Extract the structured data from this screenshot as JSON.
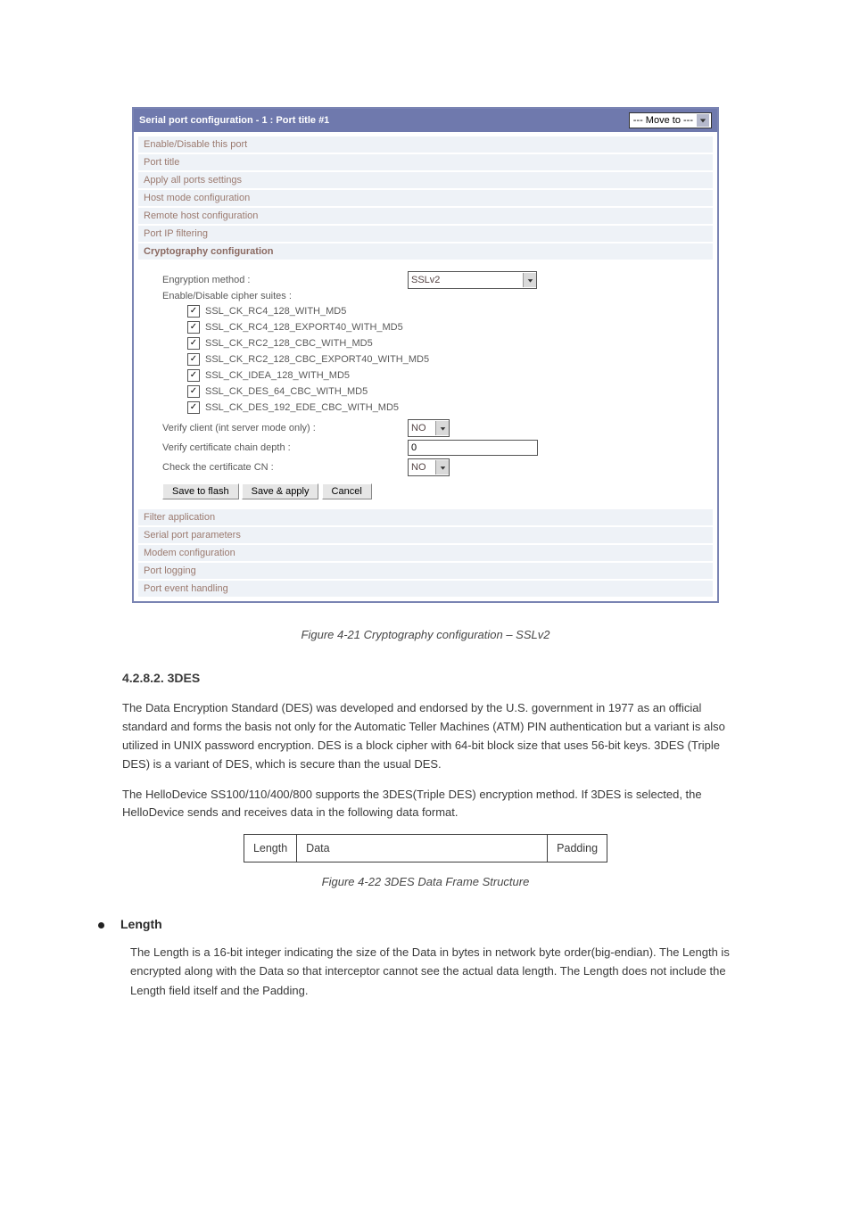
{
  "titlebar": {
    "title": "Serial port configuration - 1 : Port title #1",
    "move_to": "--- Move to ---"
  },
  "nav_top": [
    "Enable/Disable this port",
    "Port title",
    "Apply all ports settings",
    "Host mode configuration",
    "Remote host configuration",
    "Port IP filtering"
  ],
  "active_section": "Cryptography configuration",
  "form": {
    "encryption_label": "Engryption method :",
    "encryption_value": "SSLv2",
    "cipher_head": "Enable/Disable cipher suites :",
    "ciphers": [
      "SSL_CK_RC4_128_WITH_MD5",
      "SSL_CK_RC4_128_EXPORT40_WITH_MD5",
      "SSL_CK_RC2_128_CBC_WITH_MD5",
      "SSL_CK_RC2_128_CBC_EXPORT40_WITH_MD5",
      "SSL_CK_IDEA_128_WITH_MD5",
      "SSL_CK_DES_64_CBC_WITH_MD5",
      "SSL_CK_DES_192_EDE_CBC_WITH_MD5"
    ],
    "verify_client_label": "Verify client (int server mode only) :",
    "verify_client_value": "NO",
    "cert_depth_label": "Verify certificate chain depth :",
    "cert_depth_value": "0",
    "check_cn_label": "Check the certificate CN :",
    "check_cn_value": "NO",
    "btn_save_flash": "Save to flash",
    "btn_save_apply": "Save & apply",
    "btn_cancel": "Cancel"
  },
  "nav_bottom": [
    "Filter application",
    "Serial port parameters",
    "Modem configuration",
    "Port logging",
    "Port event handling"
  ],
  "fig_caption": "Figure 4-21 Cryptography configuration – SSLv2",
  "threedes": {
    "heading": "4.2.8.2.  3DES",
    "para1": "The Data Encryption Standard (DES) was developed and endorsed by the U.S. government in 1977 as an official standard and forms the basis not only for the Automatic Teller Machines (ATM) PIN authentication but a variant is also utilized in UNIX password encryption. DES is a block cipher with 64-bit block size that uses 56-bit keys. 3DES (Triple DES) is a variant of DES, which is secure than the usual DES.",
    "para2": "The HelloDevice SS100/110/400/800 supports the 3DES(Triple DES) encryption method. If 3DES is selected, the HelloDevice sends and receives data in the following data format.",
    "frame_cols": [
      "Length",
      "Data",
      "Padding"
    ],
    "frame_caption": "Figure 4-22 3DES Data Frame Structure"
  },
  "length_section": {
    "title": "Length",
    "body": "The Length is a 16-bit integer indicating the size of the Data in bytes in network byte order(big-endian). The Length is encrypted along with the Data so that interceptor cannot see the actual data length. The Length does not include the Length field itself and the Padding."
  }
}
